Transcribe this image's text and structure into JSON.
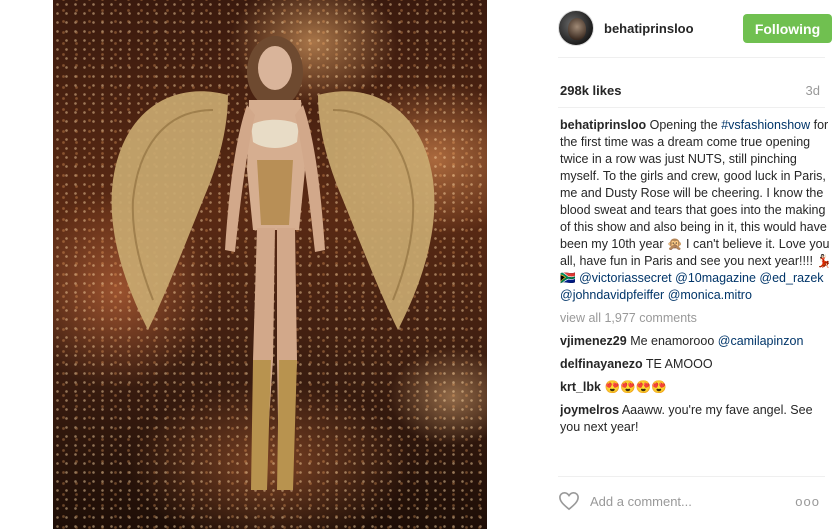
{
  "post": {
    "username": "behatiprinsloo",
    "follow_label": "Following",
    "likes": "298k likes",
    "age": "3d",
    "caption": {
      "user": "behatiprinsloo",
      "text_1": " Opening the ",
      "hashtag": "#vsfashionshow",
      "text_2": " for the first time was a dream come true opening twice in a row was just NUTS, still pinching myself. To the girls and crew, good luck in Paris, me and Dusty Rose will be cheering. I know the blood sweat and tears that goes into the making of this show and also being in it, this would have been my 10th year 🙊 I can't believe it. Love you all, have fun in Paris and see you next year!!!! 💃🏻🇿🇦",
      "mentions": [
        "@victoriassecret",
        "@10magazine",
        "@ed_razek",
        "@johndavidpfeiffer",
        "@monica.mitro"
      ]
    },
    "view_all": "view all 1,977 comments",
    "comments": [
      {
        "user": "vjimenez29",
        "text": " Me enamorooo ",
        "mention": "@camilapinzon"
      },
      {
        "user": "delfinayanezo",
        "text": " TE AMOOO",
        "mention": ""
      },
      {
        "user": "krt_lbk",
        "text": " 😍😍😍😍",
        "mention": ""
      },
      {
        "user": "joymelros",
        "text": " Aaaww. you're my fave angel. See you next year!",
        "mention": ""
      }
    ],
    "add_comment_placeholder": "Add a comment...",
    "more_label": "ooo"
  },
  "icons": {
    "heart": "heart-icon",
    "avatar": "avatar"
  },
  "colors": {
    "follow_button": "#70c050",
    "link": "#003569",
    "muted": "#999999"
  }
}
